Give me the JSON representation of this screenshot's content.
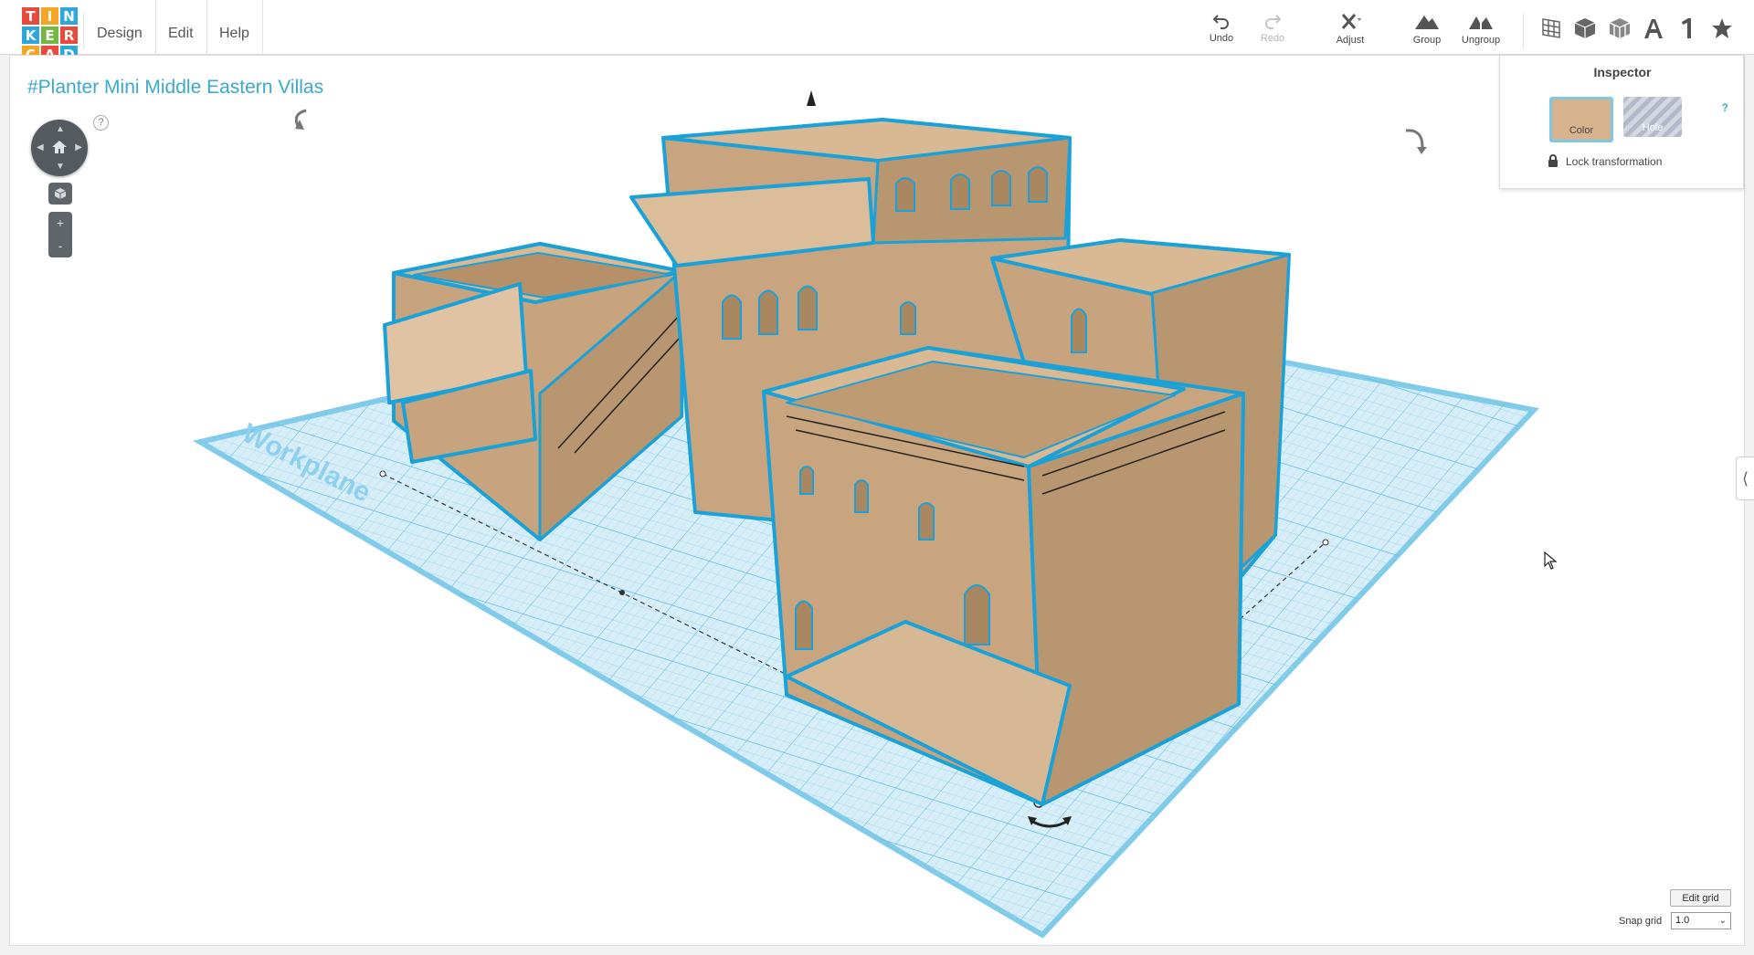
{
  "logo": {
    "letters": [
      "T",
      "I",
      "N",
      "K",
      "E",
      "R",
      "C",
      "A",
      "D"
    ],
    "colors": [
      "#e84b3c",
      "#f6a623",
      "#2ea7de",
      "#2ea7de",
      "#74b842",
      "#e84b3c",
      "#f6a623",
      "#e84b3c",
      "#2ea7de"
    ]
  },
  "menu": {
    "design": "Design",
    "edit": "Edit",
    "help": "Help"
  },
  "toolbar": {
    "undo": "Undo",
    "redo": "Redo",
    "adjust": "Adjust",
    "group": "Group",
    "ungroup": "Ungroup"
  },
  "view_icons": [
    "grid-view-icon",
    "box-view-icon",
    "wireframe-icon",
    "text-shape-icon",
    "number-shape-icon",
    "favorites-star-icon"
  ],
  "design": {
    "title": "#Planter Mini Middle Eastern Villas"
  },
  "workplane": {
    "label": "Workplane"
  },
  "nav": {
    "help": "?",
    "zoom_in": "+",
    "zoom_out": "-"
  },
  "inspector": {
    "title": "Inspector",
    "help": "?",
    "color_label": "Color",
    "hole_label": "Hole",
    "lock_label": "Lock transformation",
    "color_value": "#d8b48e"
  },
  "grid": {
    "edit_label": "Edit grid",
    "snap_label": "Snap grid",
    "snap_value": "1.0"
  },
  "colors": {
    "accent": "#3aa9cf",
    "selection": "#1fa3d8",
    "model": "#d8b48e"
  }
}
